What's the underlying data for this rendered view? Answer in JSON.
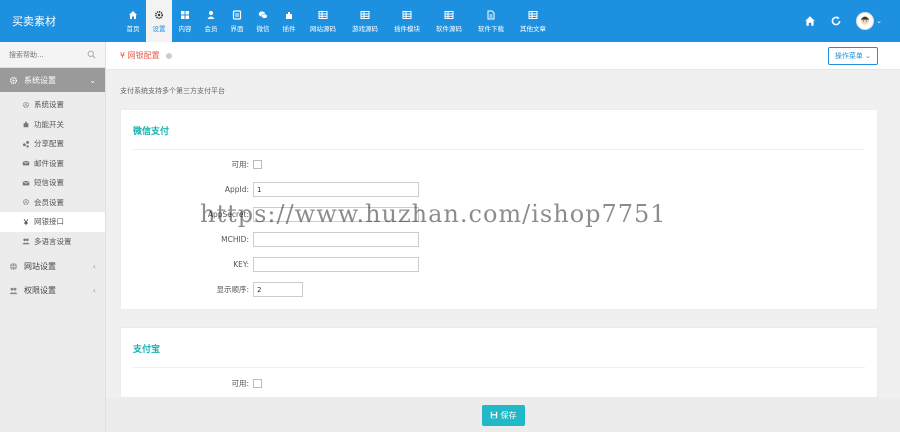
{
  "brand": "买卖素材",
  "nav": [
    {
      "label": "首页",
      "icon": "home-icon"
    },
    {
      "label": "设置",
      "icon": "gear-icon",
      "active": true
    },
    {
      "label": "内容",
      "icon": "grid-icon"
    },
    {
      "label": "会员",
      "icon": "user-icon"
    },
    {
      "label": "界面",
      "icon": "palette-icon"
    },
    {
      "label": "微信",
      "icon": "wechat-icon"
    },
    {
      "label": "插件",
      "icon": "plugin-icon"
    },
    {
      "label": "网站源码",
      "icon": "table-icon"
    },
    {
      "label": "游戏源码",
      "icon": "table-icon"
    },
    {
      "label": "插件模块",
      "icon": "table-icon"
    },
    {
      "label": "软件源码",
      "icon": "table-icon"
    },
    {
      "label": "软件下载",
      "icon": "file-icon"
    },
    {
      "label": "其他文章",
      "icon": "table-icon"
    }
  ],
  "sidebar": {
    "search_placeholder": "搜索帮助...",
    "group_system": "系统设置",
    "items": [
      {
        "label": "系统设置",
        "icon": "gear-icon"
      },
      {
        "label": "功能开关",
        "icon": "toggle-icon"
      },
      {
        "label": "分享配置",
        "icon": "share-icon"
      },
      {
        "label": "邮件设置",
        "icon": "mail-icon"
      },
      {
        "label": "短信设置",
        "icon": "mail-icon"
      },
      {
        "label": "会员设置",
        "icon": "gear-icon"
      },
      {
        "label": "网银接口",
        "icon": "yen-icon"
      },
      {
        "label": "多语言设置",
        "icon": "users-icon"
      }
    ],
    "group_site": "网站设置",
    "group_perm": "权限设置"
  },
  "tab": {
    "label": "¥ 网银配置"
  },
  "op_menu": "操作菜单 ⌄",
  "desc": "支付系统支持多个第三方支付平台",
  "wechat": {
    "title": "微信支付",
    "enable_label": "可用:",
    "appid_label": "AppId:",
    "appid_value": "1",
    "appsecret_label": "AppSecret:",
    "appsecret_value": "",
    "mchid_label": "MCHID:",
    "mchid_value": "",
    "key_label": "KEY:",
    "key_value": "",
    "order_label": "显示顺序:",
    "order_value": "2"
  },
  "alipay": {
    "title": "支付宝",
    "enable_label": "可用:"
  },
  "save_label": "保存",
  "watermark": "https://www.huzhan.com/ishop7751",
  "colors": {
    "primary": "#1e90e0",
    "accent": "#22b8c8",
    "tab": "#e25c4a"
  }
}
